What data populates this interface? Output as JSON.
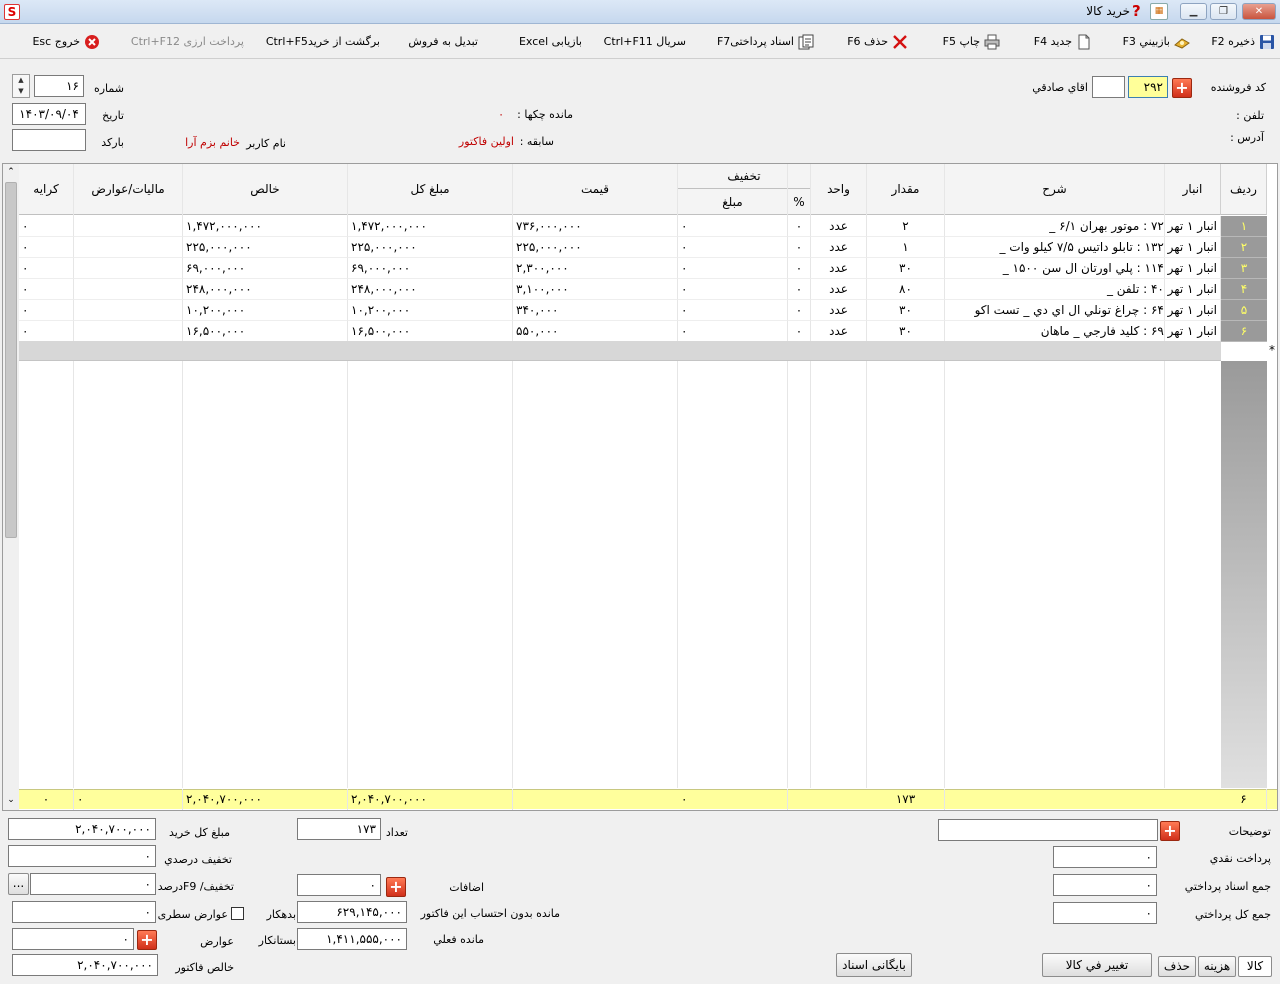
{
  "window": {
    "title": "خرید کالا"
  },
  "toolbar": {
    "save": "ذخیره F2",
    "review": "بازبيني F3",
    "new": "جدید F4",
    "print": "چاپ F5",
    "delete": "حذف F6",
    "payment_docs": "اسناد پرداختیF7",
    "serial": "سریال Ctrl+F11",
    "excel": "بازیابی Excel",
    "convert_sale": "تبدیل به فروش",
    "return_purchase": "برگشت از خریدCtrl+F5",
    "currency_payment": "پرداخت ارزی Ctrl+F12",
    "exit": "خروج Esc"
  },
  "header": {
    "vendor_code_label": "کد فروشنده",
    "vendor_code": "۲۹۲",
    "vendor_name": "اقاي صادقي",
    "phone_label": "تلفن :",
    "address_label": "آدرس :",
    "checks_balance_label": "مانده چکها :",
    "checks_balance": "۰",
    "history_label": "سابقه :",
    "history_value": "اولین فاکتور",
    "username_label": "نام کاربر",
    "username_value": "خانم بزم آرا",
    "number_label": "شماره",
    "number_value": "۱۶",
    "date_label": "تاریخ",
    "date_value": "۱۴۰۳/۰۹/۰۴",
    "barcode_label": "بارکد"
  },
  "grid": {
    "headers": {
      "row": "ردیف",
      "warehouse": "انبار",
      "desc": "شرح",
      "qty": "مقدار",
      "unit": "واحد",
      "discount": "تخفیف",
      "discount_pct": "%",
      "discount_amt": "مبلغ",
      "price": "قیمت",
      "total": "مبلغ کل",
      "net": "خالص",
      "tax": "ماليات/عوارض",
      "fare": "کرایه"
    },
    "rows": [
      {
        "idx": "۱",
        "desc": "انبار ۱ تهر ۷۲ : موتور بهران ۶/۱ _",
        "qty": "۲",
        "unit": "عدد",
        "pct": "۰",
        "disc": "۰",
        "price": "۷۳۶,۰۰۰,۰۰۰",
        "total": "۱,۴۷۲,۰۰۰,۰۰۰",
        "net": "۱,۴۷۲,۰۰۰,۰۰۰",
        "tax": "",
        "fare": "۰"
      },
      {
        "idx": "۲",
        "desc": "انبار ۱ تهر ۱۳۲ : تابلو داتیس ۷/۵ کیلو وات _",
        "qty": "۱",
        "unit": "عدد",
        "pct": "۰",
        "disc": "۰",
        "price": "۲۲۵,۰۰۰,۰۰۰",
        "total": "۲۲۵,۰۰۰,۰۰۰",
        "net": "۲۲۵,۰۰۰,۰۰۰",
        "tax": "",
        "fare": "۰"
      },
      {
        "idx": "۳",
        "desc": "انبار ۱ تهر ۱۱۴ : پلي اورتان ال سن ۱۵۰۰ _",
        "qty": "۳۰",
        "unit": "عدد",
        "pct": "۰",
        "disc": "۰",
        "price": "۲,۳۰۰,۰۰۰",
        "total": "۶۹,۰۰۰,۰۰۰",
        "net": "۶۹,۰۰۰,۰۰۰",
        "tax": "",
        "fare": "۰"
      },
      {
        "idx": "۴",
        "desc": "انبار ۱ تهر ۴۰ : تلفن _",
        "qty": "۸۰",
        "unit": "عدد",
        "pct": "۰",
        "disc": "۰",
        "price": "۳,۱۰۰,۰۰۰",
        "total": "۲۴۸,۰۰۰,۰۰۰",
        "net": "۲۴۸,۰۰۰,۰۰۰",
        "tax": "",
        "fare": "۰"
      },
      {
        "idx": "۵",
        "desc": "انبار ۱ تهر ۶۴ : چراغ تونلي ال اي دي _ تست اکو",
        "qty": "۳۰",
        "unit": "عدد",
        "pct": "۰",
        "disc": "۰",
        "price": "۳۴۰,۰۰۰",
        "total": "۱۰,۲۰۰,۰۰۰",
        "net": "۱۰,۲۰۰,۰۰۰",
        "tax": "",
        "fare": "۰"
      },
      {
        "idx": "۶",
        "desc": "انبار ۱ تهر ۶۹ : کليد فارجي _ ماهان",
        "qty": "۳۰",
        "unit": "عدد",
        "pct": "۰",
        "disc": "۰",
        "price": "۵۵۰,۰۰۰",
        "total": "۱۶,۵۰۰,۰۰۰",
        "net": "۱۶,۵۰۰,۰۰۰",
        "tax": "",
        "fare": "۰"
      }
    ],
    "new_row_marker": "*",
    "summary": {
      "count": "۶",
      "qty": "۱۷۳",
      "disc": "۰",
      "total": "۲,۰۴۰,۷۰۰,۰۰۰",
      "net": "۲,۰۴۰,۷۰۰,۰۰۰",
      "tax": "۰",
      "fare": "۰"
    }
  },
  "footer": {
    "notes_label": "توضیحات",
    "cash_label": "پرداخت نقدي",
    "cash_value": "۰",
    "payment_docs_label": "جمع اسناد پرداختي",
    "payment_docs_value": "۰",
    "total_payment_label": "جمع کل پرداختي",
    "total_payment_value": "۰",
    "count_label": "تعداد",
    "count_value": "۱۷۳",
    "additions_label": "اضافات",
    "additions_value": "۰",
    "balance_excl_label": "مانده بدون احتساب این فاکتور",
    "balance_excl_value": "۶۲۹,۱۴۵,۰۰۰",
    "debtor_label": "بدهکار",
    "current_balance_label": "مانده فعلي",
    "current_balance_value": "۱,۴۱۱,۵۵۵,۰۰۰",
    "creditor_label": "بستانکار",
    "total_purchase_label": "مبلغ کل خرید",
    "total_purchase_value": "۲,۰۴۰,۷۰۰,۰۰۰",
    "pct_discount_label": "تخفیف درصدي",
    "pct_discount_value": "۰",
    "discount_f9_label": "تخفیف/ F9درصد",
    "discount_f9_value": "۰",
    "more_button": "...",
    "line_charges_label": "عوارض سطری",
    "line_charges_value": "۰",
    "charges_label": "عوارض",
    "charges_value": "۰",
    "net_invoice_label": "خالص فاکتور",
    "net_invoice_value": "۲,۰۴۰,۷۰۰,۰۰۰",
    "archive_button": "بایگانی اسناد",
    "change_goods_button": "تغییر في کالا",
    "delete_button": "حذف",
    "expense_tab": "هزینه",
    "goods_tab": "کالا"
  }
}
